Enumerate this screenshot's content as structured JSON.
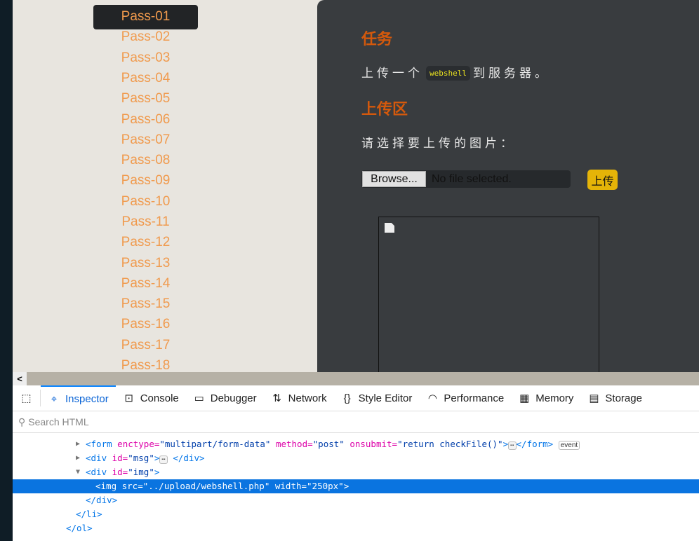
{
  "nav": {
    "items": [
      "Pass-01",
      "Pass-02",
      "Pass-03",
      "Pass-04",
      "Pass-05",
      "Pass-06",
      "Pass-07",
      "Pass-08",
      "Pass-09",
      "Pass-10",
      "Pass-11",
      "Pass-12",
      "Pass-13",
      "Pass-14",
      "Pass-15",
      "Pass-16",
      "Pass-17",
      "Pass-18"
    ],
    "active": "Pass-01"
  },
  "panel": {
    "task_heading": "任务",
    "task_pre": "上传一个",
    "task_code": "webshell",
    "task_post": "到服务器。",
    "upload_heading": "上传区",
    "prompt": "请选择要上传的图片：",
    "browse": "Browse...",
    "no_file": "No file selected.",
    "submit": "上传"
  },
  "devtools": {
    "tabs": [
      "Inspector",
      "Console",
      "Debugger",
      "Network",
      "Style Editor",
      "Performance",
      "Memory",
      "Storage"
    ],
    "search_placeholder": "Search HTML",
    "tree": {
      "l1_tag": "<form",
      "l1_a1": " enctype=",
      "l1_v1": "\"multipart/form-data\"",
      "l1_a2": " method=",
      "l1_v2": "\"post\"",
      "l1_a3": " onsubmit=",
      "l1_v3": "\"return checkFile()\"",
      "l1_end": ">",
      "l1_close": "</form>",
      "event": "event",
      "l2_tag": "<div",
      "l2_a": " id=",
      "l2_v": "\"msg\"",
      "l2_end": ">",
      "l2_close": "</div>",
      "l3_tag": "<div",
      "l3_a": " id=",
      "l3_v": "\"img\"",
      "l3_end": ">",
      "l4": "<img src=\"../upload/webshell.php\" width=\"250px\">",
      "l5": "</div>",
      "l6": "</li>",
      "l7": "</ol>"
    }
  }
}
